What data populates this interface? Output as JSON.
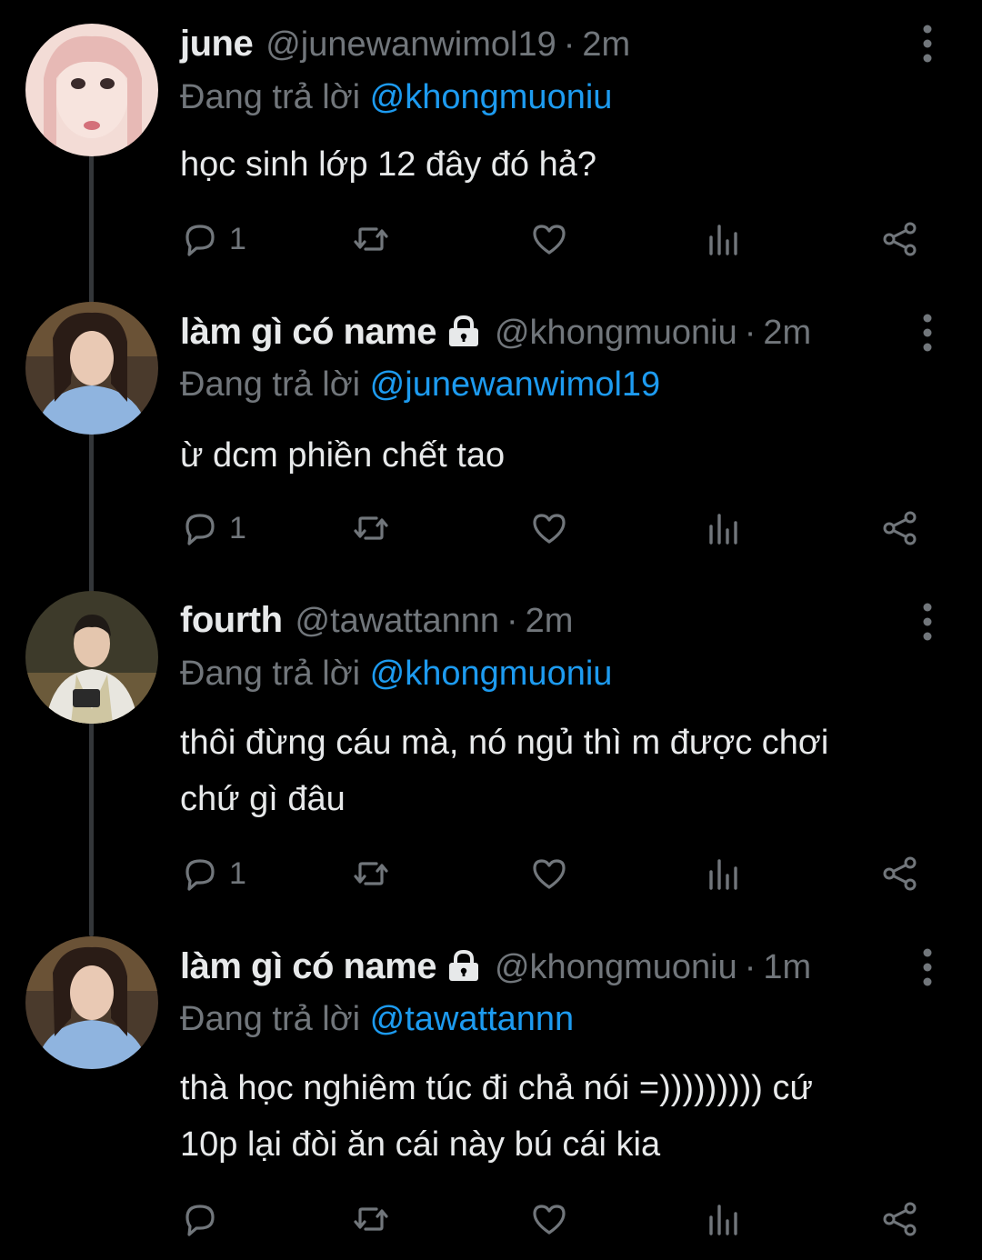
{
  "tweets": [
    {
      "display_name": "june",
      "handle": "@junewanwimol19",
      "time": "2m",
      "replying_prefix": "Đang trả lời",
      "replying_to": "@khongmuoniu",
      "text_lines": [
        "học sinh lớp 12 đây đó hả?"
      ],
      "reply_count": "1",
      "locked": false
    },
    {
      "display_name": "làm gì có name",
      "handle": "@khongmuoniu",
      "time": "2m",
      "replying_prefix": "Đang trả lời",
      "replying_to": "@junewanwimol19",
      "text_lines": [
        "ừ dcm phiền chết tao"
      ],
      "reply_count": "1",
      "locked": true
    },
    {
      "display_name": "fourth",
      "handle": "@tawattannn",
      "time": "2m",
      "replying_prefix": "Đang trả lời",
      "replying_to": "@khongmuoniu",
      "text_lines": [
        "thôi đừng cáu mà, nó ngủ thì m được chơi",
        "chứ gì đâu"
      ],
      "reply_count": "1",
      "locked": false
    },
    {
      "display_name": "làm gì có name",
      "handle": "@khongmuoniu",
      "time": "1m",
      "replying_prefix": "Đang trả lời",
      "replying_to": "@tawattannn",
      "text_lines": [
        "thà học nghiêm túc đi chả nói =))))))))) cứ",
        "10p lại đòi ăn cái này bú cái kia"
      ],
      "reply_count": "",
      "locked": false
    }
  ],
  "separator": "·",
  "colors": {
    "background": "#000000",
    "text_primary": "#e7e9ea",
    "text_secondary": "#71767b",
    "mention": "#1d9bf0",
    "thread_line": "#333639"
  },
  "icons": [
    "reply-icon",
    "retweet-icon",
    "like-icon",
    "views-icon",
    "share-icon",
    "more-icon",
    "lock-icon"
  ]
}
